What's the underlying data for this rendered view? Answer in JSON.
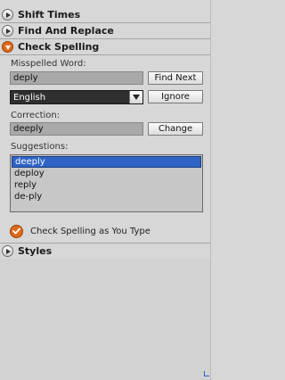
{
  "sections": {
    "shift_times": "Shift Times",
    "find_replace": "Find And Replace",
    "check_spelling": "Check Spelling",
    "styles": "Styles"
  },
  "spell": {
    "misspelled_label": "Misspelled Word:",
    "misspelled_value": "deply",
    "find_next": "Find Next",
    "language": "English",
    "ignore": "Ignore",
    "correction_label": "Correction:",
    "correction_value": "deeply",
    "change": "Change",
    "suggestions_label": "Suggestions:",
    "suggestions": [
      "deeply",
      "deploy",
      "reply",
      "de-ply"
    ],
    "selected_index": 0,
    "check_as_you_type": "Check Spelling as You Type",
    "check_as_you_type_on": true
  },
  "colors": {
    "accent": "#e06a1a",
    "selection": "#2f63c4"
  }
}
